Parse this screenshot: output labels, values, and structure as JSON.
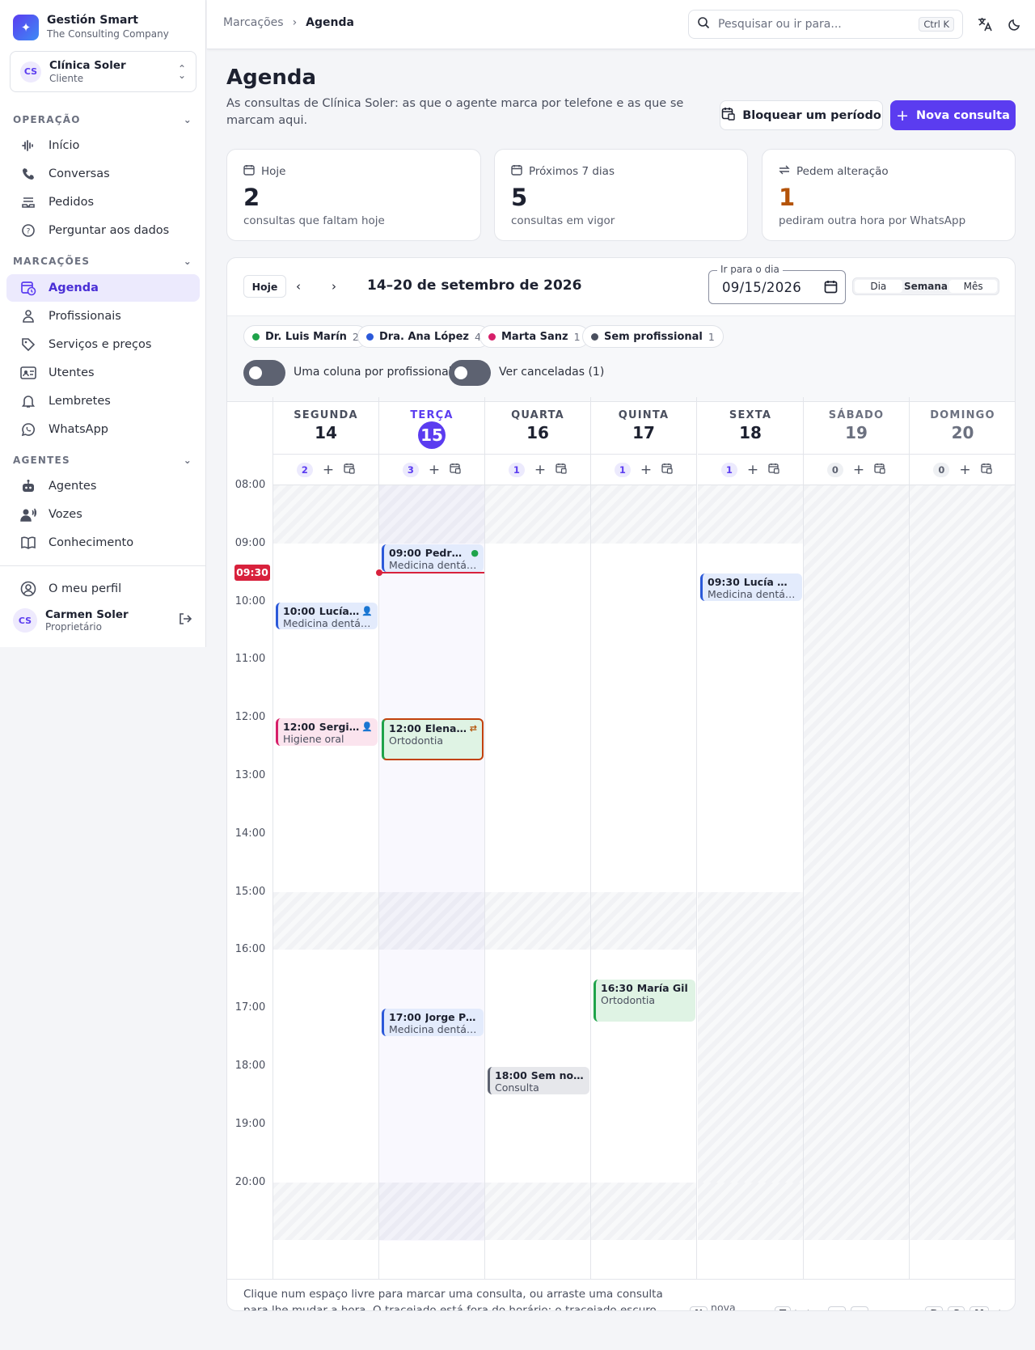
{
  "brand": {
    "name": "Gestión Smart",
    "company": "The Consulting Company",
    "logo_icon": "sparkle-icon"
  },
  "client": {
    "initials": "CS",
    "name": "Clínica Soler",
    "role": "Cliente"
  },
  "nav": {
    "sections": [
      {
        "label": "OPERAÇÃO",
        "items": [
          "Início",
          "Conversas",
          "Pedidos",
          "Perguntar aos dados"
        ]
      },
      {
        "label": "MARCAÇÕES",
        "items": [
          "Agenda",
          "Profissionais",
          "Serviços e preços",
          "Utentes",
          "Lembretes",
          "WhatsApp"
        ]
      },
      {
        "label": "AGENTES",
        "items": [
          "Agentes",
          "Vozes",
          "Conhecimento"
        ]
      }
    ],
    "active": "Agenda"
  },
  "profile": {
    "label": "O meu perfil",
    "initials": "CS",
    "name": "Carmen Soler",
    "role": "Proprietário"
  },
  "breadcrumb": {
    "parent": "Marcações",
    "current": "Agenda"
  },
  "search": {
    "placeholder": "Pesquisar ou ir para...",
    "shortcut": "Ctrl K"
  },
  "page": {
    "title": "Agenda",
    "description": "As consultas de Clínica Soler: as que o agente marca por telefone e as que se marcam aqui.",
    "block_button": "Bloquear um período",
    "new_button": "Nova consulta"
  },
  "stats": [
    {
      "label": "Hoje",
      "value": "2",
      "sub": "consultas que faltam hoje",
      "color": "#1d2130"
    },
    {
      "label": "Próximos 7 dias",
      "value": "5",
      "sub": "consultas em vigor",
      "color": "#1d2130"
    },
    {
      "label": "Pedem alteração",
      "value": "1",
      "sub": "pediram outra hora por WhatsApp",
      "color": "#b45309"
    }
  ],
  "calendar": {
    "today_button": "Hoje",
    "range": "14–20 de setembro de 2026",
    "goto_label": "Ir para o dia",
    "goto_value": "09/15/2026",
    "views": [
      "Dia",
      "Semana",
      "Mês"
    ],
    "active_view": "Semana",
    "professionals": [
      {
        "name": "Dr. Luis Marín",
        "count": "2",
        "color": "#1fa34a"
      },
      {
        "name": "Dra. Ana López",
        "count": "4",
        "color": "#2b59d9"
      },
      {
        "name": "Marta Sanz",
        "count": "1",
        "color": "#d61f69"
      },
      {
        "name": "Sem profissional",
        "count": "1",
        "color": "#4a4f5e"
      }
    ],
    "toggles": [
      "Uma coluna por profissional",
      "Ver canceladas (1)"
    ],
    "days": [
      {
        "name": "SEGUNDA",
        "num": "14",
        "count": "2"
      },
      {
        "name": "TERÇA",
        "num": "15",
        "count": "3",
        "today": true
      },
      {
        "name": "QUARTA",
        "num": "16",
        "count": "1"
      },
      {
        "name": "QUINTA",
        "num": "17",
        "count": "1"
      },
      {
        "name": "SEXTA",
        "num": "18",
        "count": "1"
      },
      {
        "name": "SÁBADO",
        "num": "19",
        "count": "0"
      },
      {
        "name": "DOMINGO",
        "num": "20",
        "count": "0"
      }
    ],
    "hours": [
      "08:00",
      "09:00",
      "10:00",
      "11:00",
      "12:00",
      "13:00",
      "14:00",
      "15:00",
      "16:00",
      "17:00",
      "18:00",
      "19:00",
      "20:00"
    ],
    "now_label": "09:30",
    "events": [
      {
        "day": 0,
        "time": "10:00",
        "name": "Lucía Martín",
        "service": "Medicina dentária",
        "start": 10.0,
        "end": 10.5,
        "color": "#2b59d9",
        "bg": "#e3ebfc",
        "icon": "person-check-icon"
      },
      {
        "day": 0,
        "time": "12:00",
        "name": "Sergio Ruiz",
        "service": "Higiene oral",
        "start": 12.0,
        "end": 12.5,
        "color": "#d61f69",
        "bg": "#fbe4ee",
        "icon": "people-icon"
      },
      {
        "day": 1,
        "time": "09:00",
        "name": "Pedro Díaz",
        "service": "Medicina dentária",
        "start": 9.0,
        "end": 9.5,
        "color": "#2b59d9",
        "bg": "#e3ebfc",
        "icon": "check-circle-icon"
      },
      {
        "day": 1,
        "time": "12:00",
        "name": "Elena Ramos",
        "service": "Ortodontia",
        "start": 12.0,
        "end": 12.75,
        "color": "#1fa34a",
        "bg": "#dff3e4",
        "icon": "swap-icon",
        "border": "#c2410c"
      },
      {
        "day": 1,
        "time": "17:00",
        "name": "Jorge Pardo",
        "service": "Medicina dentária",
        "start": 17.0,
        "end": 17.5,
        "color": "#2b59d9",
        "bg": "#e3ebfc"
      },
      {
        "day": 2,
        "time": "18:00",
        "name": "Sem nome",
        "service": "Consulta",
        "start": 18.0,
        "end": 18.5,
        "color": "#5d6271",
        "bg": "#e6e7eb"
      },
      {
        "day": 3,
        "time": "16:30",
        "name": "María Gil",
        "service": "Ortodontia",
        "start": 16.5,
        "end": 17.25,
        "color": "#1fa34a",
        "bg": "#dff3e4"
      },
      {
        "day": 4,
        "time": "09:30",
        "name": "Lucía Martín",
        "service": "Medicina dentária",
        "start": 9.5,
        "end": 10.0,
        "color": "#2b59d9",
        "bg": "#e3ebfc"
      }
    ],
    "footer_text": "Clique num espaço livre para marcar uma consulta, ou arraste uma consulta para lhe mudar a hora. O tracejado está fora do horário; o tracejado escuro está bloqueado (clique para o ver ou remover).",
    "shortcuts": [
      {
        "keys": [
          "N"
        ],
        "label": "nova consulta"
      },
      {
        "keys": [
          "T"
        ],
        "label": "hoje"
      },
      {
        "keys": [
          "←",
          "→"
        ],
        "label": "navegar"
      },
      {
        "keys": [
          "D",
          "S",
          "M"
        ],
        "label": "vista"
      }
    ]
  }
}
